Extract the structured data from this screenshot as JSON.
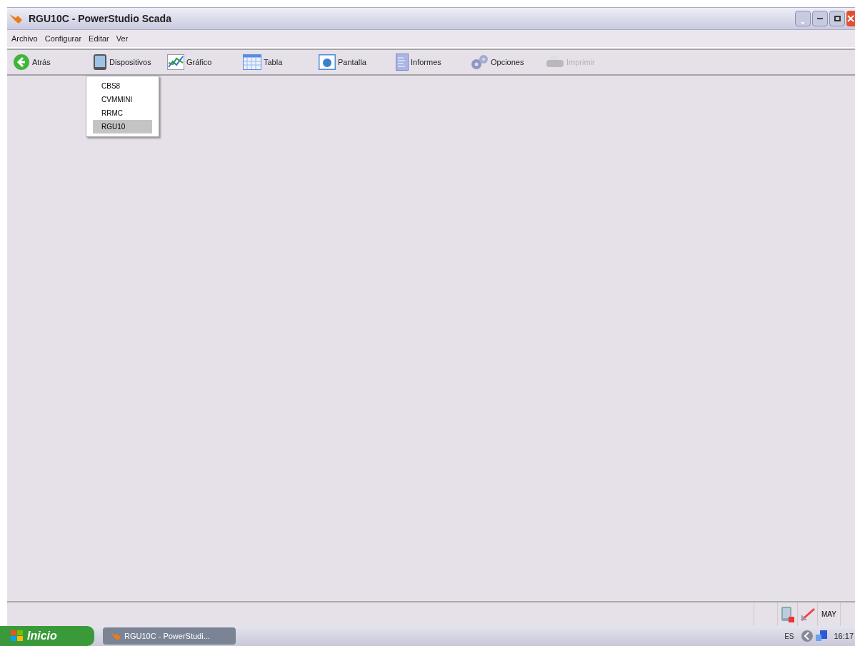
{
  "window": {
    "title": "RGU10C - PowerStudio Scada"
  },
  "menu_bar": [
    "Archivo",
    "Configurar",
    "Editar",
    "Ver"
  ],
  "toolbar": [
    {
      "kind": "back",
      "label": "Atrás",
      "disabled": false
    },
    {
      "kind": "devices",
      "label": "Dispositivos",
      "disabled": false
    },
    {
      "kind": "chart",
      "label": "Gráfico",
      "disabled": false
    },
    {
      "kind": "table",
      "label": "Tabla",
      "disabled": false
    },
    {
      "kind": "screen",
      "label": "Pantalla",
      "disabled": false
    },
    {
      "kind": "reports",
      "label": "Informes",
      "disabled": false
    },
    {
      "kind": "options",
      "label": "Opciones",
      "disabled": false
    },
    {
      "kind": "print",
      "label": "Imprimir",
      "disabled": true
    }
  ],
  "devices_menu": [
    {
      "label": "CBS8",
      "selected": false
    },
    {
      "label": "CVMMINI",
      "selected": false
    },
    {
      "label": "RRMC",
      "selected": false
    },
    {
      "label": "RGU10",
      "selected": true
    }
  ],
  "status_bar": {
    "caps_indicator": "MAY"
  },
  "taskbar": {
    "start_label": "Inicio",
    "task": "RGU10C - PowerStudi...",
    "language": "ES",
    "clock": "16:17"
  }
}
